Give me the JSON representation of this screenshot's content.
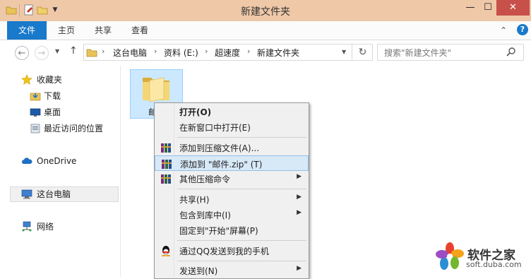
{
  "window": {
    "title": "新建文件夹",
    "controls": {
      "minimize": "—",
      "maximize": "☐",
      "close": "✕"
    }
  },
  "ribbon": {
    "tabs": [
      "文件",
      "主页",
      "共享",
      "查看"
    ],
    "active_tab": "文件",
    "accent": "#1979ca",
    "collapse_chevron": "⌃",
    "help": "?"
  },
  "address": {
    "crumbs": [
      "这台电脑",
      "资料 (E:)",
      "超速度",
      "新建文件夹"
    ],
    "search_placeholder": "搜索\"新建文件夹\"",
    "back": "←",
    "forward": "→",
    "up": "↑",
    "refresh": "↻"
  },
  "sidebar": {
    "favorites_label": "收藏夹",
    "favorites": [
      "下载",
      "桌面",
      "最近访问的位置"
    ],
    "onedrive": "OneDrive",
    "this_pc": "这台电脑",
    "network": "网络"
  },
  "content": {
    "folder_label_partial": "邮"
  },
  "context_menu": {
    "items": [
      {
        "label": "打开(O)",
        "bold": true
      },
      {
        "label": "在新窗口中打开(E)"
      },
      {
        "label": "添加到压缩文件(A)...",
        "icon": "winrar-icon"
      },
      {
        "label": "添加到 \"邮件.zip\" (T)",
        "icon": "winrar-icon",
        "highlighted": true
      },
      {
        "label": "其他压缩命令",
        "icon": "winrar-icon",
        "submenu": true
      },
      {
        "label": "共享(H)",
        "submenu": true
      },
      {
        "label": "包含到库中(I)",
        "submenu": true
      },
      {
        "label": "固定到\"开始\"屏幕(P)"
      },
      {
        "label": "通过QQ发送到我的手机",
        "icon": "qq-icon"
      },
      {
        "label": "发送到(N)",
        "submenu": true
      }
    ]
  },
  "watermark": {
    "text": "软件之家",
    "sub": "soft.duba.com"
  }
}
